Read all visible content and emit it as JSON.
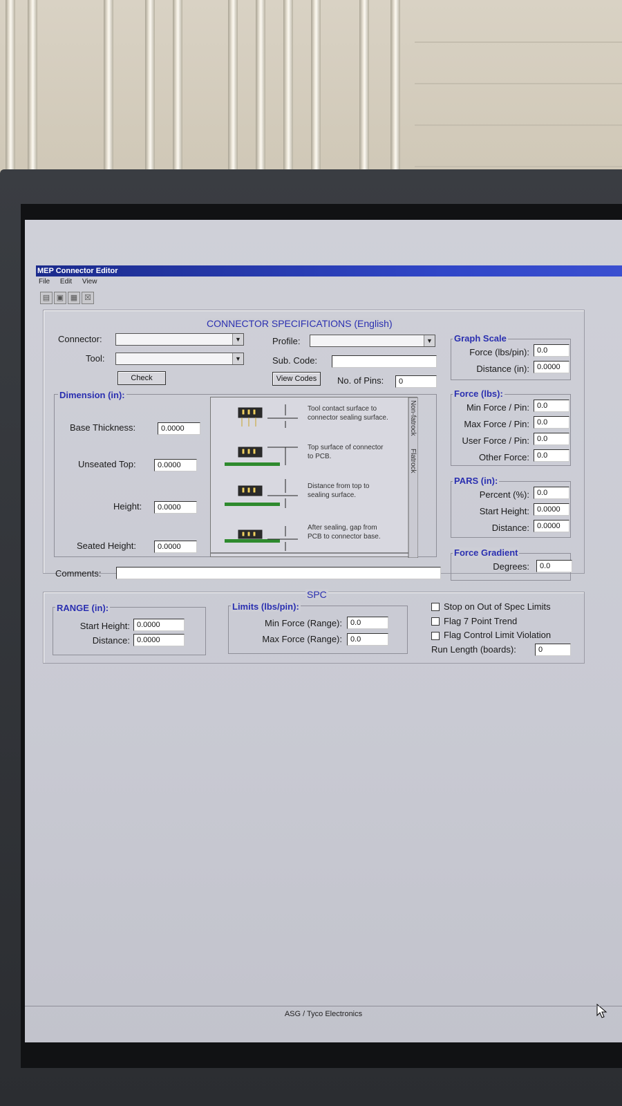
{
  "window": {
    "title": "MEP Connector Editor"
  },
  "menu": [
    "File",
    "Edit",
    "View"
  ],
  "spec": {
    "header": "CONNECTOR SPECIFICATIONS (English)",
    "connector_label": "Connector:",
    "tool_label": "Tool:",
    "check_button": "Check",
    "profile_label": "Profile:",
    "subcode_label": "Sub. Code:",
    "view_codes_button": "View Codes",
    "pins_label": "No. of Pins:",
    "pins_value": "0",
    "comments_label": "Comments:"
  },
  "dimension": {
    "title": "Dimension (in):",
    "fields": [
      {
        "label": "Base Thickness:",
        "value": "0.0000"
      },
      {
        "label": "Unseated Top:",
        "value": "0.0000"
      },
      {
        "label": "Height:",
        "value": "0.0000"
      },
      {
        "label": "Seated Height:",
        "value": "0.0000"
      }
    ],
    "descriptions": [
      [
        "Tool contact surface to",
        "connector sealing surface."
      ],
      [
        "Top surface of connector",
        "to PCB."
      ],
      [
        "Distance from top to",
        "sealing surface."
      ],
      [
        "After sealing, gap from",
        "PCB to connector base."
      ]
    ],
    "tabs": [
      "Non-fatrock",
      "Flatrock"
    ]
  },
  "graph_scale": {
    "title": "Graph Scale",
    "fields": [
      {
        "label": "Force (lbs/pin):",
        "value": "0.0"
      },
      {
        "label": "Distance (in):",
        "value": "0.0000"
      }
    ]
  },
  "force": {
    "title": "Force (lbs):",
    "fields": [
      {
        "label": "Min Force / Pin:",
        "value": "0.0"
      },
      {
        "label": "Max Force / Pin:",
        "value": "0.0"
      },
      {
        "label": "User Force / Pin:",
        "value": "0.0"
      },
      {
        "label": "Other Force:",
        "value": "0.0"
      }
    ]
  },
  "pars": {
    "title": "PARS (in):",
    "fields": [
      {
        "label": "Percent (%):",
        "value": "0.0"
      },
      {
        "label": "Start Height:",
        "value": "0.0000"
      },
      {
        "label": "Distance:",
        "value": "0.0000"
      }
    ]
  },
  "force_gradient": {
    "title": "Force Gradient",
    "fields": [
      {
        "label": "Degrees:",
        "value": "0.0"
      }
    ]
  },
  "spc": {
    "header": "SPC",
    "range": {
      "title": "RANGE (in):",
      "fields": [
        {
          "label": "Start Height:",
          "value": "0.0000"
        },
        {
          "label": "Distance:",
          "value": "0.0000"
        }
      ]
    },
    "limits": {
      "title": "Limits (lbs/pin):",
      "fields": [
        {
          "label": "Min Force (Range):",
          "value": "0.0"
        },
        {
          "label": "Max Force (Range):",
          "value": "0.0"
        }
      ]
    },
    "checks": [
      "Stop on Out of Spec Limits",
      "Flag 7 Point Trend",
      "Flag Control Limit Violation"
    ],
    "run_length_label": "Run Length (boards):",
    "run_length_value": "0"
  },
  "status": {
    "text": "ASG / Tyco Electronics"
  },
  "colors": {
    "titlebar": "#1b2b8c",
    "group_title": "#2a2fb0",
    "screen_bg": "#cfd0d8"
  }
}
